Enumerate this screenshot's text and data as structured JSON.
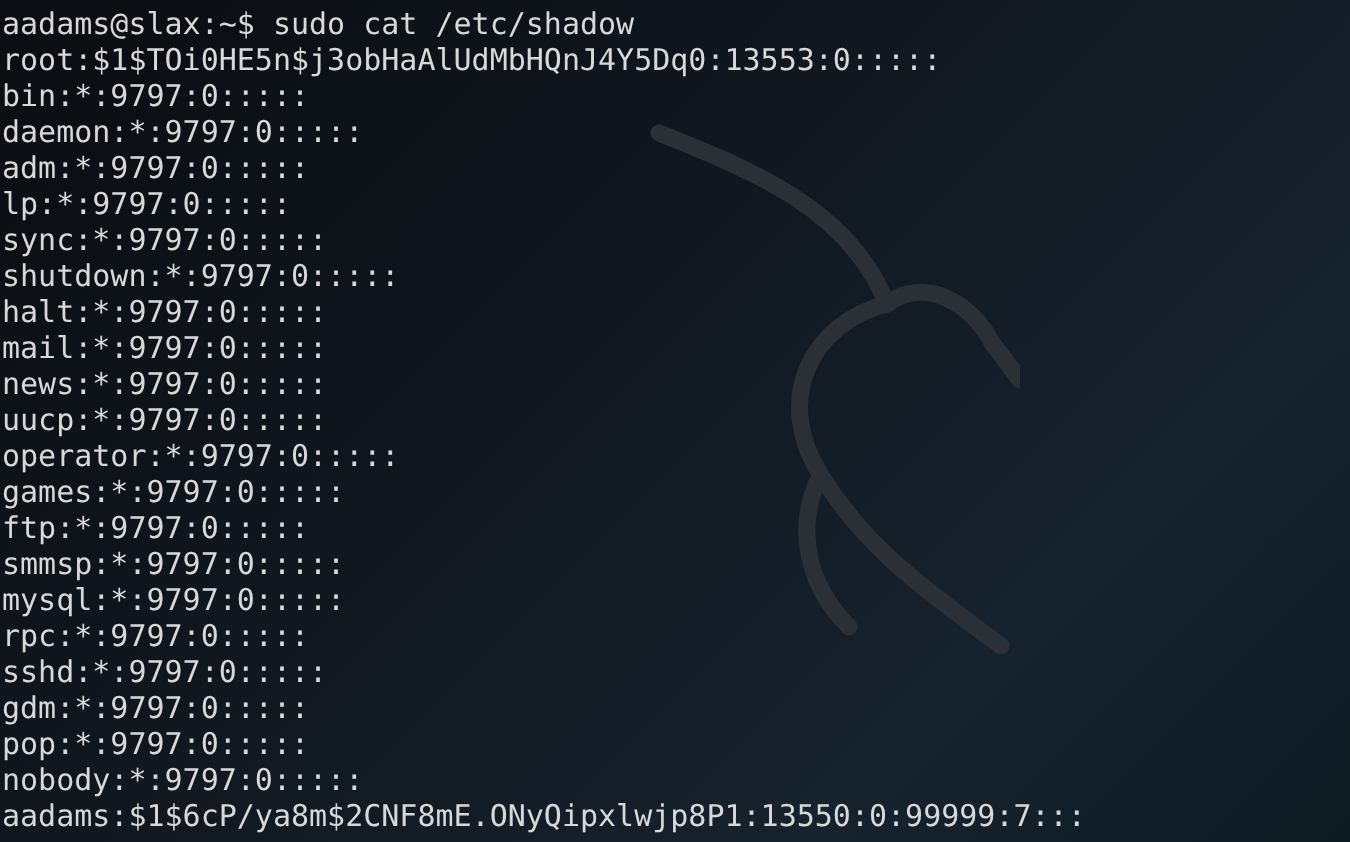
{
  "terminal": {
    "prompt": "aadams@slax:~$",
    "command": "sudo cat /etc/shadow",
    "output": [
      "root:$1$TOi0HE5n$j3obHaAlUdMbHQnJ4Y5Dq0:13553:0:::::",
      "bin:*:9797:0:::::",
      "daemon:*:9797:0:::::",
      "adm:*:9797:0:::::",
      "lp:*:9797:0:::::",
      "sync:*:9797:0:::::",
      "shutdown:*:9797:0:::::",
      "halt:*:9797:0:::::",
      "mail:*:9797:0:::::",
      "news:*:9797:0:::::",
      "uucp:*:9797:0:::::",
      "operator:*:9797:0:::::",
      "games:*:9797:0:::::",
      "ftp:*:9797:0:::::",
      "smmsp:*:9797:0:::::",
      "mysql:*:9797:0:::::",
      "rpc:*:9797:0:::::",
      "sshd:*:9797:0:::::",
      "gdm:*:9797:0:::::",
      "pop:*:9797:0:::::",
      "nobody:*:9797:0:::::",
      "aadams:$1$6cP/ya8m$2CNF8mE.ONyQipxlwjp8P1:13550:0:99999:7:::"
    ]
  }
}
